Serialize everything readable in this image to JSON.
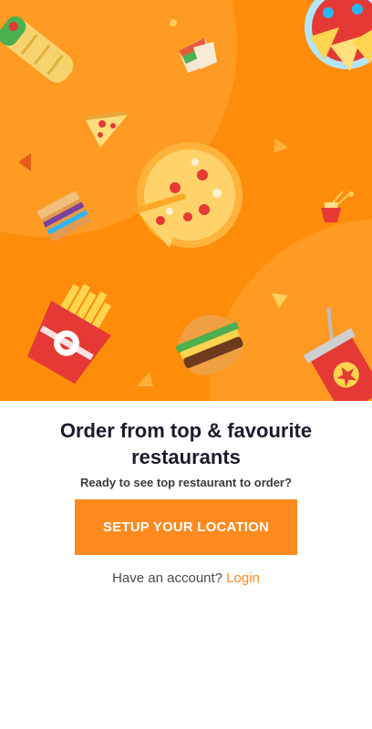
{
  "hero": {
    "colors": {
      "background": "#ff8c0a",
      "circle": "#ff9f2a"
    },
    "icons": [
      "burrito-icon",
      "sandwich-icon",
      "pizza-slice-icon",
      "pizza-icon",
      "noodle-box-icon",
      "cake-icon",
      "fries-icon",
      "burger-icon",
      "soda-cup-icon",
      "nachos-plate-icon"
    ]
  },
  "onboarding": {
    "title_line1": "Order from top & favourite",
    "title_line2": "restaurants",
    "subtitle": "Ready to see top restaurant to order?",
    "cta_label": "SETUP YOUR LOCATION",
    "account_prompt": "Have an account?",
    "login_label": "Login"
  },
  "colors": {
    "accent": "#ff8a1e",
    "title": "#1b1b2b",
    "text": "#4a4a4a"
  }
}
